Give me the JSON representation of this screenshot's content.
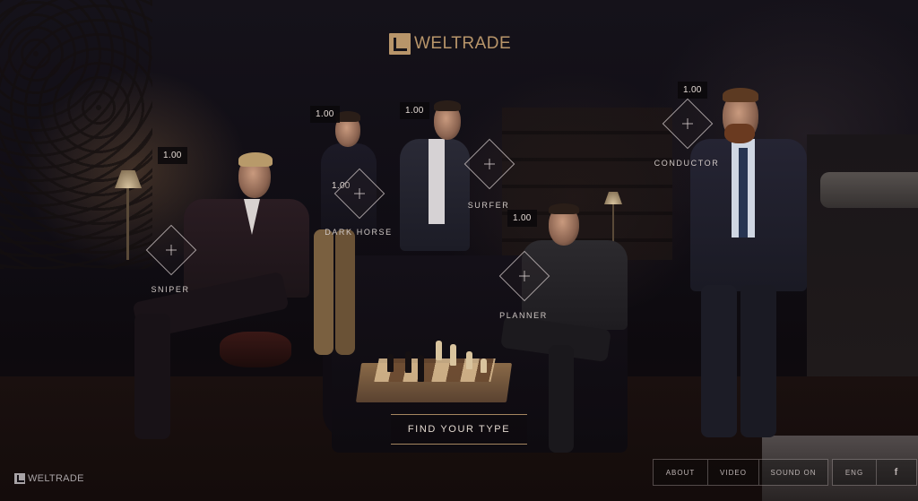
{
  "brand": {
    "logo_text": "WELTRADE",
    "footer_logo_text": "WELTRADE",
    "accent_color": "#b8956a"
  },
  "types": [
    {
      "label": "SNIPER",
      "price": "1.00"
    },
    {
      "label": "DARK HORSE",
      "price": "1.00"
    },
    {
      "label": "SURFER",
      "price": "1.00"
    },
    {
      "label": "PLANNER",
      "price": "1.00"
    },
    {
      "label": "CONDUCTOR",
      "price": "1.00"
    }
  ],
  "extra_prices": [
    "1.00",
    "1.00"
  ],
  "cta": {
    "label": "FIND YOUR TYPE"
  },
  "nav": {
    "items": [
      "ABOUT",
      "VIDEO",
      "SOUND ON"
    ],
    "language": "ENG",
    "social_icon": "facebook-icon",
    "social_glyph": "f"
  }
}
